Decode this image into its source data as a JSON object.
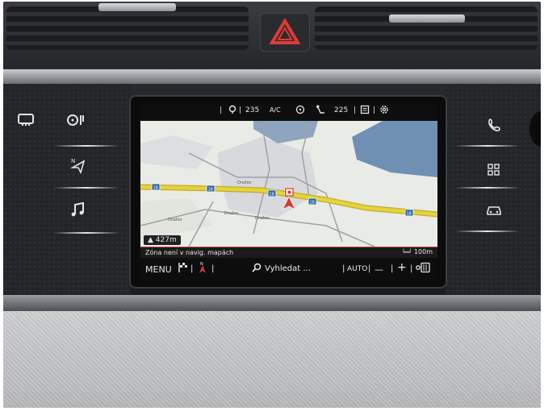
{
  "status_bar": {
    "fan_temp_left": "235",
    "ac_label": "A/C",
    "fan_temp_right": "225"
  },
  "map": {
    "route_badge": "18",
    "road_labels": [
      "Dražov",
      "Dražov",
      "Dražov",
      "Dražov"
    ],
    "distance_to_turn": "427m",
    "scale": "100m"
  },
  "info_bar": {
    "message": "Zóna není v navig. mapách"
  },
  "bottom_bar": {
    "menu_label": "MENU",
    "search_label": "Vyhledat ...",
    "auto_label": "AUTO",
    "zoom_out": "—",
    "zoom_in": "+"
  },
  "colors": {
    "route": "#e8d23a",
    "accent_red": "#d23c36",
    "water": "#6f8fb3",
    "land": "#e9ebe6"
  }
}
